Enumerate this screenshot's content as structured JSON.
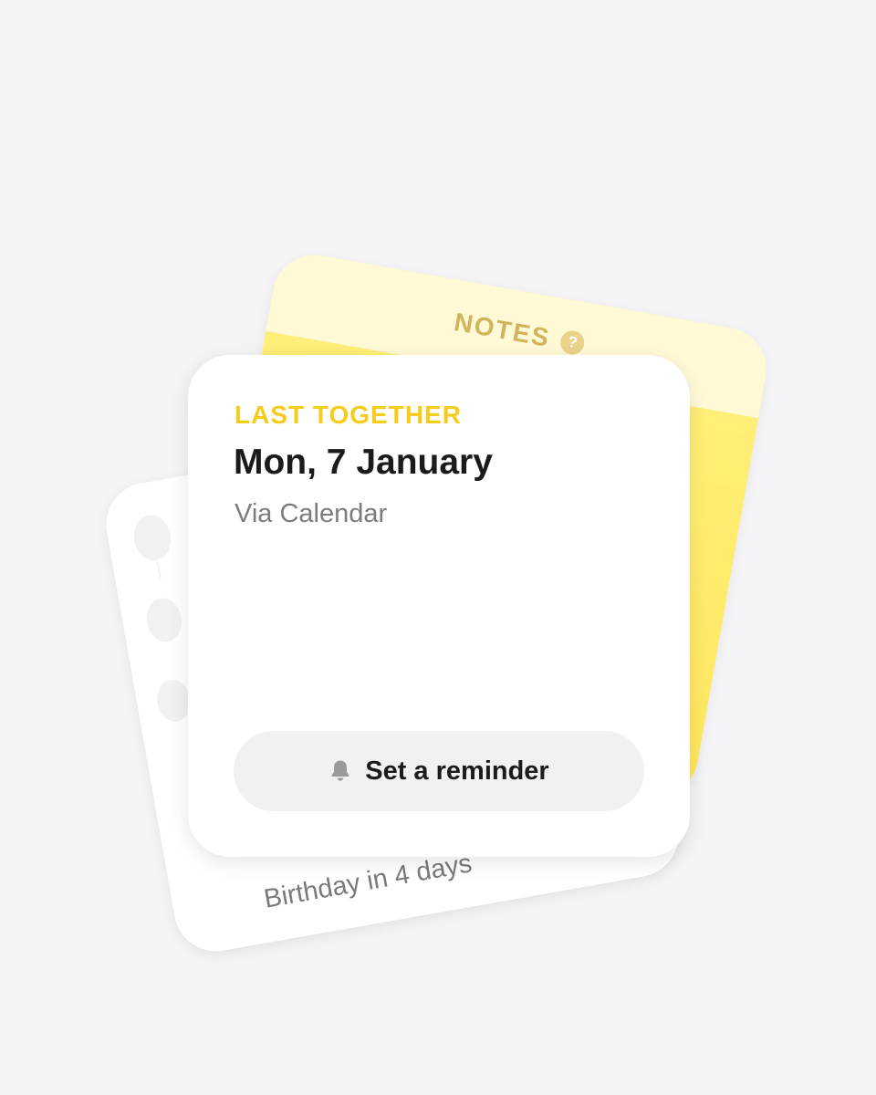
{
  "birthday_card": {
    "text": "Birthday in 4 days",
    "icon": "balloons-icon"
  },
  "notes_card": {
    "title": "NOTES",
    "help_icon": "question-mark-icon",
    "help_glyph": "?",
    "accent_color": "#ffe65c"
  },
  "front_card": {
    "eyebrow": "LAST TOGETHER",
    "date": "Mon, 7 January",
    "source": "Via Calendar",
    "reminder_button": {
      "label": "Set a reminder",
      "icon": "bell-icon"
    },
    "accent_color": "#f6cc1c"
  }
}
